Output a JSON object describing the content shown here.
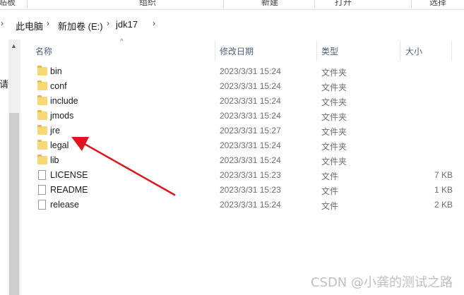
{
  "ribbon": {
    "groups": [
      "贴板",
      "组织",
      "新建",
      "打开",
      "选择"
    ]
  },
  "address": {
    "crumbs": [
      "此电脑",
      "新加卷 (E:)",
      "jdk17"
    ]
  },
  "nav": {
    "partial_label": "请"
  },
  "columns": {
    "name": "名称",
    "date": "修改日期",
    "type": "类型",
    "size": "大小"
  },
  "files": [
    {
      "name": "bin",
      "date": "2023/3/31 15:24",
      "type": "文件夹",
      "size": "",
      "icon": "folder-icon"
    },
    {
      "name": "conf",
      "date": "2023/3/31 15:24",
      "type": "文件夹",
      "size": "",
      "icon": "folder-icon"
    },
    {
      "name": "include",
      "date": "2023/3/31 15:24",
      "type": "文件夹",
      "size": "",
      "icon": "folder-icon"
    },
    {
      "name": "jmods",
      "date": "2023/3/31 15:24",
      "type": "文件夹",
      "size": "",
      "icon": "folder-icon"
    },
    {
      "name": "jre",
      "date": "2023/3/31 15:27",
      "type": "文件夹",
      "size": "",
      "icon": "folder-icon"
    },
    {
      "name": "legal",
      "date": "2023/3/31 15:24",
      "type": "文件夹",
      "size": "",
      "icon": "folder-icon"
    },
    {
      "name": "lib",
      "date": "2023/3/31 15:24",
      "type": "文件夹",
      "size": "",
      "icon": "folder-icon"
    },
    {
      "name": "LICENSE",
      "date": "2023/3/31 15:23",
      "type": "文件",
      "size": "7 KB",
      "icon": "file-icon"
    },
    {
      "name": "README",
      "date": "2023/3/31 15:23",
      "type": "文件",
      "size": "1 KB",
      "icon": "file-icon"
    },
    {
      "name": "release",
      "date": "2023/3/31 15:24",
      "type": "文件",
      "size": "2 KB",
      "icon": "file-icon"
    }
  ],
  "annotation": {
    "color": "#e0141e"
  },
  "watermark": "CSDN @小龚的测试之路"
}
